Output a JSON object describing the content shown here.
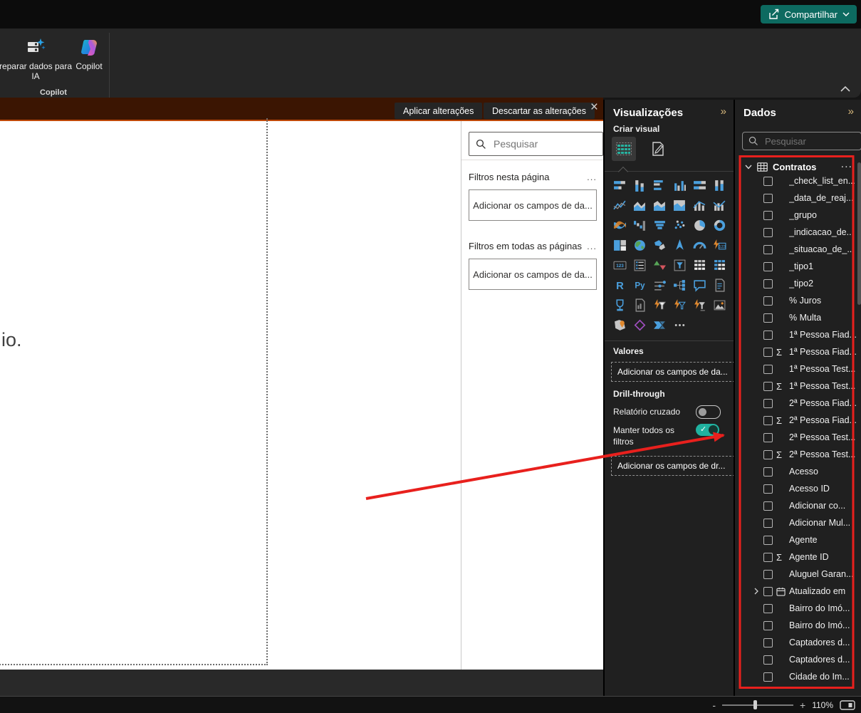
{
  "titlebar": {
    "share": "Compartilhar"
  },
  "ribbon": {
    "prepare_button": "reparar dados para IA",
    "copilot_button": "Copilot",
    "group_label": "Copilot"
  },
  "banner": {
    "apply": "Aplicar alterações",
    "discard": "Descartar as alterações"
  },
  "canvas": {
    "text_fragment": "io."
  },
  "filters": {
    "search_placeholder": "Pesquisar",
    "page_section": "Filtros nesta página",
    "all_pages_section": "Filtros em todas as páginas",
    "drop_placeholder": "Adicionar os campos de da...",
    "more": "..."
  },
  "visualizations": {
    "title": "Visualizações",
    "expand": "»",
    "create_visual": "Criar visual",
    "values_label": "Valores",
    "values_placeholder": "Adicionar os campos de da...",
    "drillthrough_label": "Drill-through",
    "cross_report_label": "Relatório cruzado",
    "keep_filters_label": "Manter todos os filtros",
    "drill_placeholder": "Adicionar os campos de dr...",
    "gallery": [
      "stacked-bar-chart",
      "stacked-column-chart",
      "clustered-bar-chart",
      "clustered-column-chart",
      "100-stacked-bar-chart",
      "100-stacked-column-chart",
      "line-chart",
      "area-chart",
      "stacked-area-chart",
      "100-stacked-area-chart",
      "line-and-stacked-column-chart",
      "line-and-clustered-column-chart",
      "ribbon-chart",
      "waterfall-chart",
      "funnel-chart",
      "scatter-chart",
      "pie-chart",
      "donut-chart",
      "treemap",
      "map",
      "filled-map",
      "azure-map",
      "gauge",
      "card-new",
      "card",
      "multi-row-card",
      "kpi",
      "slicer",
      "table",
      "matrix",
      "r-script-visual",
      "python-visual",
      "slicer-new",
      "decomposition-tree",
      "qa-visual",
      "smart-narrative",
      "metrics",
      "paginated-report",
      "preview-visual-1",
      "preview-visual-2",
      "preview-visual-3",
      "image",
      "arcgis-map",
      "power-apps",
      "power-automate",
      "more-visuals"
    ]
  },
  "data_pane": {
    "title": "Dados",
    "expand": "»",
    "search_placeholder": "Pesquisar",
    "table_name": "Contratos",
    "more": "...",
    "fields": [
      {
        "label": "_check_list_en..."
      },
      {
        "label": "_data_de_reaj..."
      },
      {
        "label": "_grupo"
      },
      {
        "label": "_indicacao_de..."
      },
      {
        "label": "_situacao_de_..."
      },
      {
        "label": "_tipo1"
      },
      {
        "label": "_tipo2"
      },
      {
        "label": "% Juros"
      },
      {
        "label": "% Multa"
      },
      {
        "label": "1ª Pessoa Fiad..."
      },
      {
        "label": "1ª Pessoa Fiad...",
        "sigma": true
      },
      {
        "label": "1ª Pessoa Test..."
      },
      {
        "label": "1ª Pessoa Test...",
        "sigma": true
      },
      {
        "label": "2ª Pessoa Fiad..."
      },
      {
        "label": "2ª Pessoa Fiad...",
        "sigma": true
      },
      {
        "label": "2ª Pessoa Test..."
      },
      {
        "label": "2ª Pessoa Test...",
        "sigma": true
      },
      {
        "label": "Acesso"
      },
      {
        "label": "Acesso ID"
      },
      {
        "label": "Adicionar co..."
      },
      {
        "label": "Adicionar Mul..."
      },
      {
        "label": "Agente"
      },
      {
        "label": "Agente ID",
        "sigma": true
      },
      {
        "label": "Aluguel Garan..."
      },
      {
        "label": "Atualizado em",
        "expandable": true,
        "date": true
      },
      {
        "label": "Bairro do Imó..."
      },
      {
        "label": "Bairro do Imó..."
      },
      {
        "label": "Captadores d..."
      },
      {
        "label": "Captadores d..."
      },
      {
        "label": "Cidade do Im..."
      }
    ]
  },
  "status_bar": {
    "zoom": "110%"
  },
  "colors": {
    "share_button": "#0d6a60",
    "toggle_on": "#20b2a0",
    "banner_bg": "#3b1502",
    "banner_border": "#c0490a",
    "annotation_red": "#e8201d",
    "visual_icon_blue": "#4a9fdd"
  }
}
